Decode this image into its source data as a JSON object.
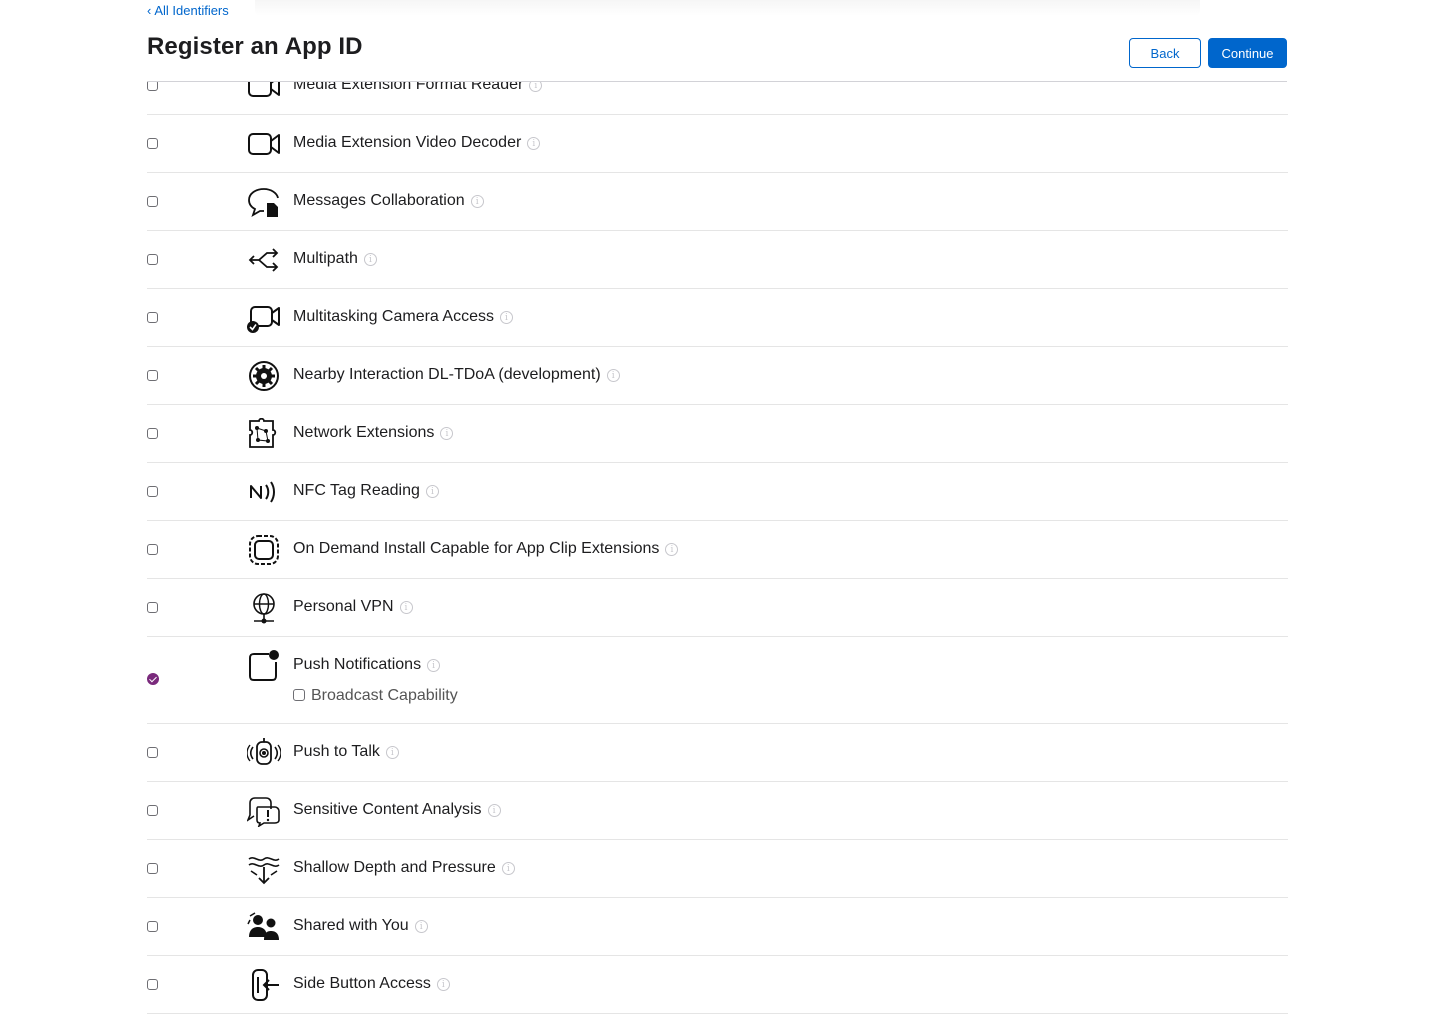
{
  "header": {
    "back_link_chevron": "‹",
    "back_link_label": "All Identifiers",
    "title": "Register an App ID",
    "back_button": "Back",
    "continue_button": "Continue"
  },
  "info_glyph": "i",
  "capabilities": [
    {
      "label": "Media Extension Format Reader",
      "icon": "video-camera-icon",
      "checked": false
    },
    {
      "label": "Media Extension Video Decoder",
      "icon": "video-camera-icon",
      "checked": false
    },
    {
      "label": "Messages Collaboration",
      "icon": "speech-bubble-document-icon",
      "checked": false
    },
    {
      "label": "Multipath",
      "icon": "multipath-arrows-icon",
      "checked": false
    },
    {
      "label": "Multitasking Camera Access",
      "icon": "camera-checkmark-icon",
      "checked": false
    },
    {
      "label": "Nearby Interaction DL-TDoA (development)",
      "icon": "gear-circle-icon",
      "checked": false
    },
    {
      "label": "Network Extensions",
      "icon": "network-puzzle-icon",
      "checked": false
    },
    {
      "label": "NFC Tag Reading",
      "icon": "nfc-icon",
      "checked": false
    },
    {
      "label": "On Demand Install Capable for App Clip Extensions",
      "icon": "app-clip-icon",
      "checked": false
    },
    {
      "label": "Personal VPN",
      "icon": "globe-network-icon",
      "checked": false
    },
    {
      "label": "Push Notifications",
      "icon": "notification-badge-icon",
      "checked": true,
      "sub_option": "Broadcast Capability"
    },
    {
      "label": "Push to Talk",
      "icon": "walkie-talkie-icon",
      "checked": false
    },
    {
      "label": "Sensitive Content Analysis",
      "icon": "speech-bubble-alert-icon",
      "checked": false
    },
    {
      "label": "Shallow Depth and Pressure",
      "icon": "depth-pressure-icon",
      "checked": false
    },
    {
      "label": "Shared with You",
      "icon": "people-icon",
      "checked": false
    },
    {
      "label": "Side Button Access",
      "icon": "side-button-icon",
      "checked": false
    }
  ],
  "colors": {
    "accent": "#0066cc",
    "checked": "#7a2a7c",
    "divider": "#e5e5e5",
    "text": "#1d1d1f"
  }
}
